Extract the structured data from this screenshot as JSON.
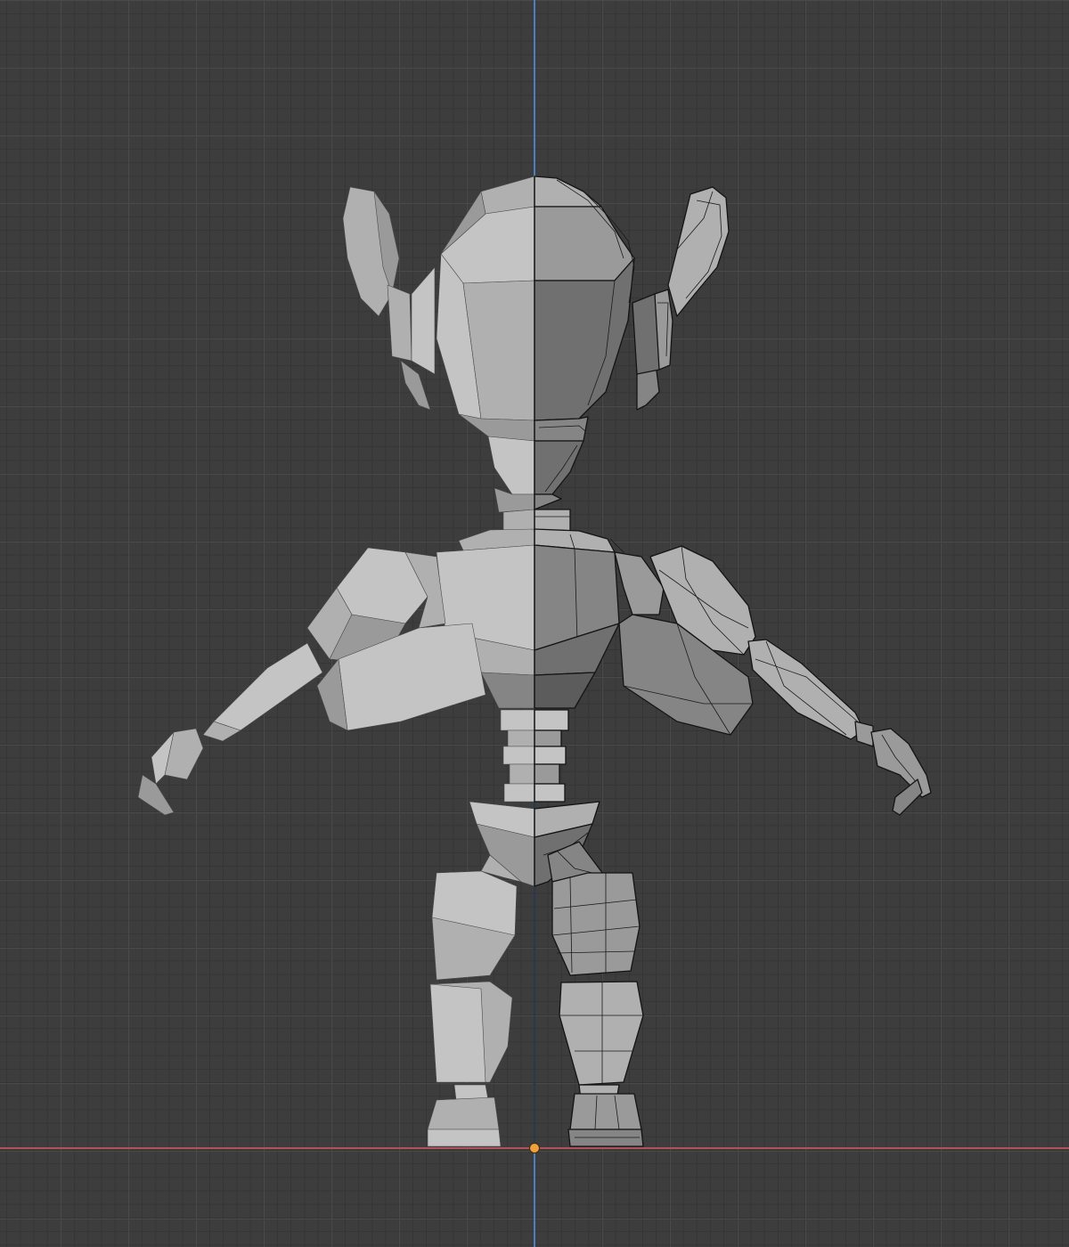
{
  "viewport": {
    "background": "#3d3d3d",
    "grid_major": "#4a4a4a",
    "grid_minor": "#353535",
    "x_axis_color": "#b5505a",
    "y_axis_color": "#4d7fc1",
    "origin_color": "#f0a03c"
  },
  "model": {
    "left_half_mode": "solid",
    "right_half_mode": "wireframe-overlay",
    "body_color": "#b4b4b4",
    "wire_color": "#141414"
  }
}
